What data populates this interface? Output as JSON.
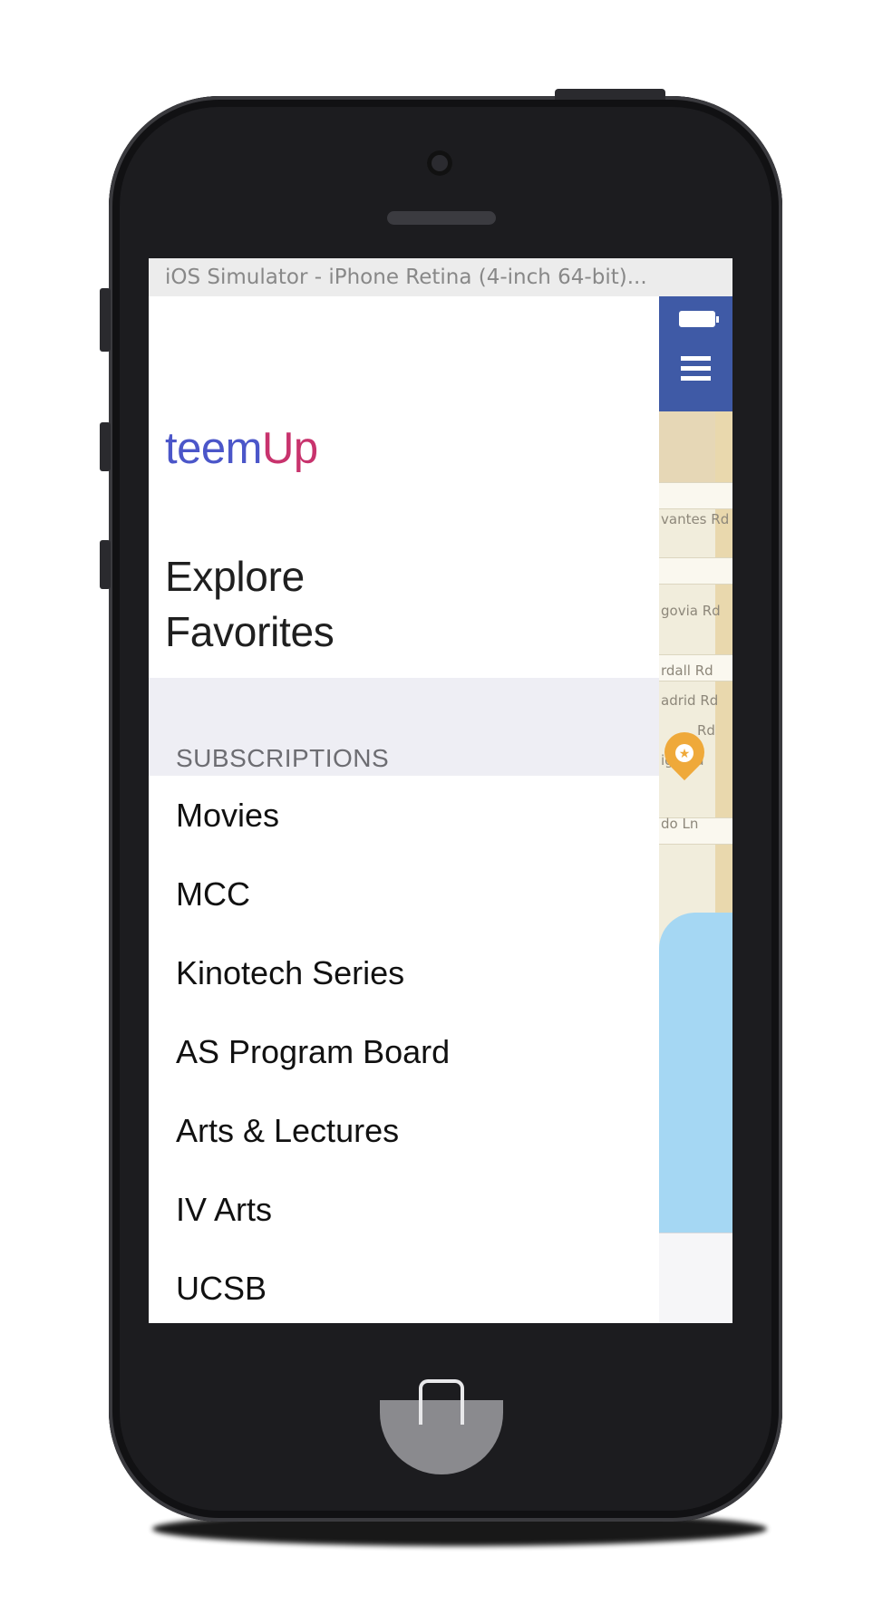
{
  "simulator": {
    "window_title": "iOS Simulator - iPhone Retina (4-inch 64-bit)..."
  },
  "drawer": {
    "logo": {
      "part1": "teem",
      "part2": "Up"
    },
    "menu": [
      "Explore",
      "Favorites"
    ],
    "section_title": "SUBSCRIPTIONS",
    "subscriptions": [
      "Movies",
      "MCC",
      "Kinotech Series",
      "AS Program Board",
      "Arts & Lectures",
      "IV Arts",
      "UCSB"
    ]
  },
  "map": {
    "street_labels": [
      "vantes Rd",
      "govia Rd",
      "rdall Rd",
      "adrid Rd",
      "Rd",
      "igo Rd",
      "do Ln"
    ],
    "nav_color": "#3f5aa6",
    "water_color": "#a5d7f3",
    "pin_color": "#efa93a"
  },
  "colors": {
    "logo_blue": "#4b56c9",
    "logo_magenta": "#c8336d",
    "section_bg": "#eeeef4"
  }
}
